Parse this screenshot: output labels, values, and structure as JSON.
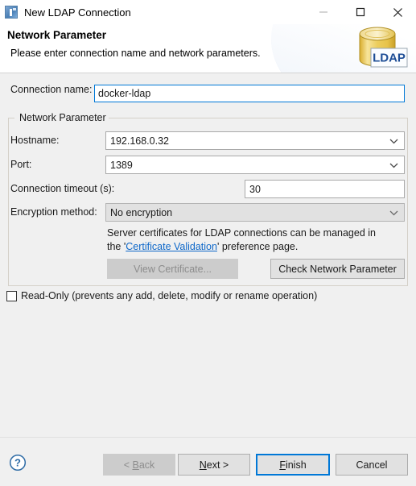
{
  "window": {
    "title": "New LDAP Connection",
    "icon": "ldap-connection-icon",
    "controls": {
      "minimize": "minimize-icon",
      "maximize": "maximize-icon",
      "close": "close-icon"
    }
  },
  "header": {
    "title": "Network Parameter",
    "subtitle": "Please enter connection name and network parameters.",
    "logo_label": "LDAP"
  },
  "form": {
    "connection_name": {
      "label": "Connection name:",
      "value": "docker-ldap",
      "placeholder": ""
    },
    "group_title": "Network Parameter",
    "hostname": {
      "label": "Hostname:",
      "value": "192.168.0.32"
    },
    "port": {
      "label": "Port:",
      "value": "1389"
    },
    "connection_timeout": {
      "label": "Connection timeout (s):",
      "value": "30"
    },
    "encryption_method": {
      "label": "Encryption method:",
      "value": "No encryption"
    },
    "cert_note": {
      "line1_pre": "Server certificates for LDAP connections can be managed in",
      "line2_pre": "the '",
      "link": "Certificate Validation",
      "line2_post": "' preference page."
    },
    "view_certificate_button": "View Certificate...",
    "check_network_button": "Check Network Parameter",
    "read_only": {
      "label": "Read-Only (prevents any add, delete, modify or rename operation)",
      "checked": false
    }
  },
  "footer": {
    "help": "?",
    "back": "< Back",
    "back_mnemonic": "B",
    "next": "Next >",
    "next_mnemonic": "N",
    "finish": "Finish",
    "finish_mnemonic": "F",
    "cancel": "Cancel"
  },
  "colors": {
    "accent": "#0078d7",
    "link": "#0d67c9",
    "dialog_bg": "#f0f0f0",
    "logo_yellow": "#e8c44a"
  }
}
